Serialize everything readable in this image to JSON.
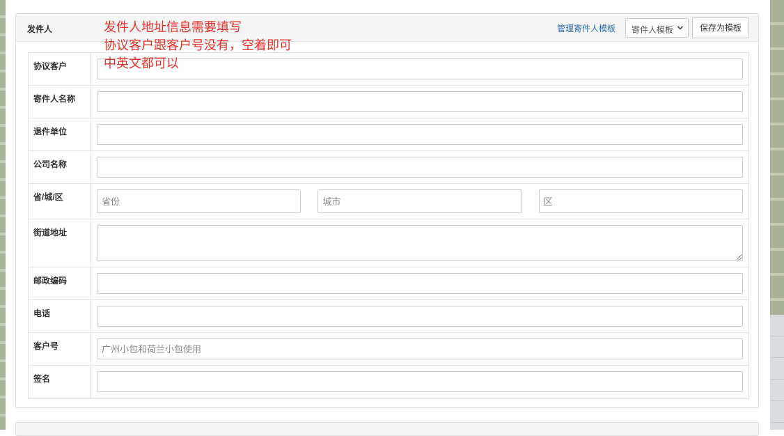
{
  "panel": {
    "title": "发件人",
    "manage_link": "管理寄件人模板",
    "template_select_value": "寄件人模板",
    "save_button": "保存为模板"
  },
  "annotation": {
    "line1": "发件人地址信息需要填写",
    "line2": "协议客户跟客户号没有，空着即可",
    "line3": "中英文都可以"
  },
  "form": {
    "agreement_customer": {
      "label": "协议客户",
      "value": ""
    },
    "sender_name": {
      "label": "寄件人名称",
      "value": ""
    },
    "return_unit": {
      "label": "退件单位",
      "value": ""
    },
    "company_name": {
      "label": "公司名称",
      "value": ""
    },
    "region": {
      "label": "省/城/区",
      "province_placeholder": "省份",
      "city_placeholder": "城市",
      "district_placeholder": "区"
    },
    "street_address": {
      "label": "街道地址",
      "value": ""
    },
    "postal_code": {
      "label": "邮政编码",
      "value": ""
    },
    "phone": {
      "label": "电话",
      "value": ""
    },
    "customer_number": {
      "label": "客户号",
      "placeholder": "广州小包和荷兰小包使用"
    },
    "signature": {
      "label": "签名",
      "value": ""
    }
  },
  "colors": {
    "annotation": "#e8302a",
    "link": "#2a6cb0"
  }
}
